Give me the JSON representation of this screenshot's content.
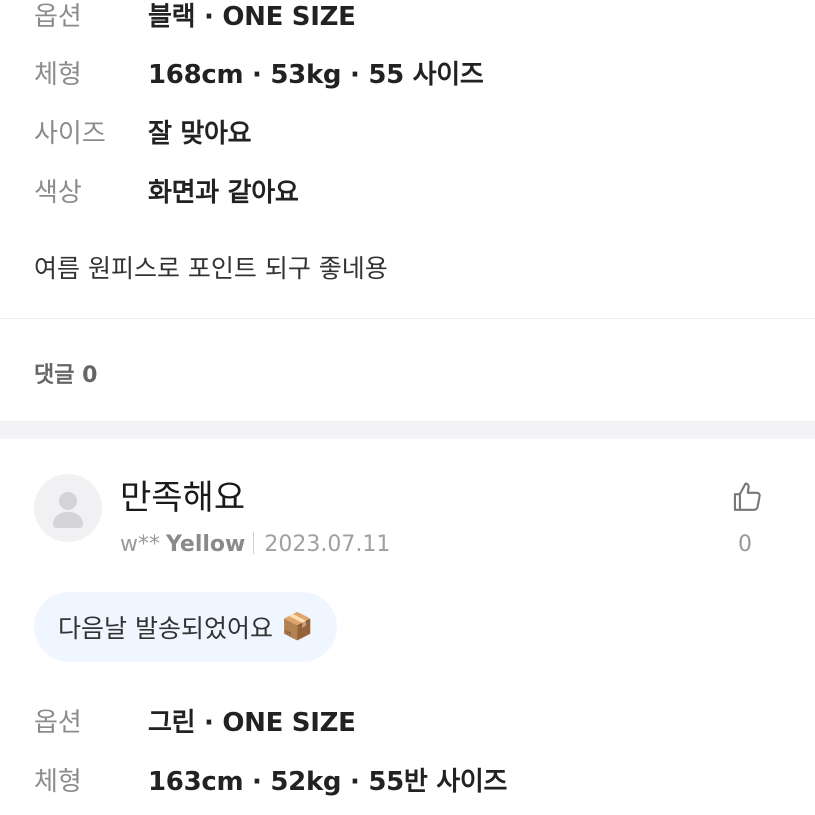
{
  "review_prev": {
    "details": [
      {
        "key": "옵션",
        "value": "블랙 · ONE SIZE"
      },
      {
        "key": "체형",
        "value": "168cm · 53kg · 55 사이즈"
      },
      {
        "key": "사이즈",
        "value": "잘 맞아요"
      },
      {
        "key": "색상",
        "value": "화면과 같아요"
      }
    ],
    "body": "여름 원피스로 포인트 되구 좋네용",
    "comments_label": "댓글 0"
  },
  "review": {
    "title": "만족해요",
    "user": "w**",
    "grade": "Yellow",
    "date": "2023.07.11",
    "like_icon": "thumbs-up-icon",
    "like_count": "0",
    "tag": "다음날 발송되었어요",
    "tag_icon": "📦",
    "details": [
      {
        "key": "옵션",
        "value": "그린 · ONE SIZE"
      },
      {
        "key": "체형",
        "value": "163cm · 52kg · 55반 사이즈"
      }
    ]
  }
}
